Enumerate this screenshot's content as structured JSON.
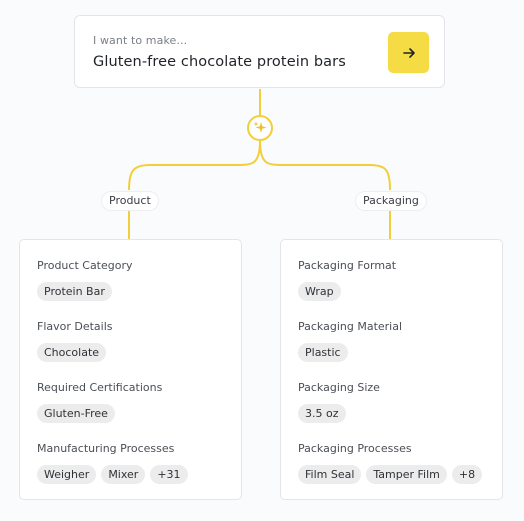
{
  "prompt": {
    "label": "I want to make...",
    "value": "Gluten-free chocolate protein bars"
  },
  "icons": {
    "submit": "arrow-right-icon",
    "generate": "sparkle-icon"
  },
  "colors": {
    "accent": "#f5dc45",
    "connector": "#f2cf3a",
    "chip_bg": "#ececed"
  },
  "branches": {
    "product": "Product",
    "packaging": "Packaging"
  },
  "product": {
    "category_label": "Product Category",
    "category_chips": [
      "Protein Bar"
    ],
    "flavor_label": "Flavor Details",
    "flavor_chips": [
      "Chocolate"
    ],
    "certifications_label": "Required Certifications",
    "certifications_chips": [
      "Gluten-Free"
    ],
    "processes_label": "Manufacturing Processes",
    "processes_chips": [
      "Weigher",
      "Mixer",
      "+31"
    ]
  },
  "packaging": {
    "format_label": "Packaging Format",
    "format_chips": [
      "Wrap"
    ],
    "material_label": "Packaging Material",
    "material_chips": [
      "Plastic"
    ],
    "size_label": "Packaging Size",
    "size_chips": [
      "3.5 oz"
    ],
    "processes_label": "Packaging Processes",
    "processes_chips": [
      "Film Seal",
      "Tamper Film",
      "+8"
    ]
  }
}
